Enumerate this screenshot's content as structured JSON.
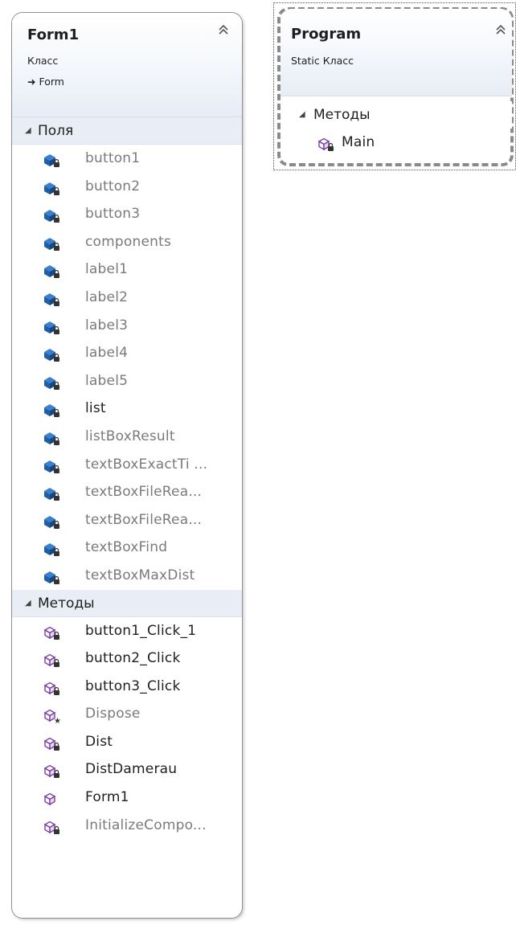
{
  "form1": {
    "title": "Form1",
    "kind": "Класс",
    "base": "Form",
    "fields_label": "Поля",
    "fields": [
      {
        "name": "button1",
        "gray": true
      },
      {
        "name": "button2",
        "gray": true
      },
      {
        "name": "button3",
        "gray": true
      },
      {
        "name": "components",
        "gray": true
      },
      {
        "name": "label1",
        "gray": true
      },
      {
        "name": "label2",
        "gray": true
      },
      {
        "name": "label3",
        "gray": true
      },
      {
        "name": "label4",
        "gray": true
      },
      {
        "name": "label5",
        "gray": true
      },
      {
        "name": "list",
        "gray": false
      },
      {
        "name": "listBoxResult",
        "gray": true
      },
      {
        "name": "textBoxExactTi ...",
        "gray": true
      },
      {
        "name": "textBoxFileRea...",
        "gray": true
      },
      {
        "name": "textBoxFileRea...",
        "gray": true
      },
      {
        "name": "textBoxFind",
        "gray": true
      },
      {
        "name": "textBoxMaxDist",
        "gray": true
      }
    ],
    "methods_label": "Методы",
    "methods": [
      {
        "name": "button1_Click_1",
        "gray": false,
        "access": "private"
      },
      {
        "name": "button2_Click",
        "gray": false,
        "access": "private"
      },
      {
        "name": "button3_Click",
        "gray": false,
        "access": "private"
      },
      {
        "name": "Dispose",
        "gray": true,
        "access": "protected"
      },
      {
        "name": "Dist",
        "gray": false,
        "access": "private"
      },
      {
        "name": "DistDamerau",
        "gray": false,
        "access": "private"
      },
      {
        "name": "Form1",
        "gray": false,
        "access": "public"
      },
      {
        "name": "InitializeCompo...",
        "gray": true,
        "access": "private"
      }
    ]
  },
  "program": {
    "title": "Program",
    "kind": "Static Класс",
    "methods_label": "Методы",
    "methods": [
      {
        "name": "Main",
        "gray": false,
        "access": "private"
      }
    ]
  },
  "icons": {
    "collapse": "double-chevron-up-icon",
    "field": "field-private-icon",
    "method": "method-icon",
    "section_toggle": "triangle-expanded-icon",
    "inherits": "arrow-right-icon"
  },
  "colors": {
    "header_gradient_end": "#e7edf6",
    "section_bg": "#e9eef6",
    "field_icon": "#1f5fa6",
    "method_icon": "#7a3fa8",
    "gray_text": "#7a7a7a"
  }
}
